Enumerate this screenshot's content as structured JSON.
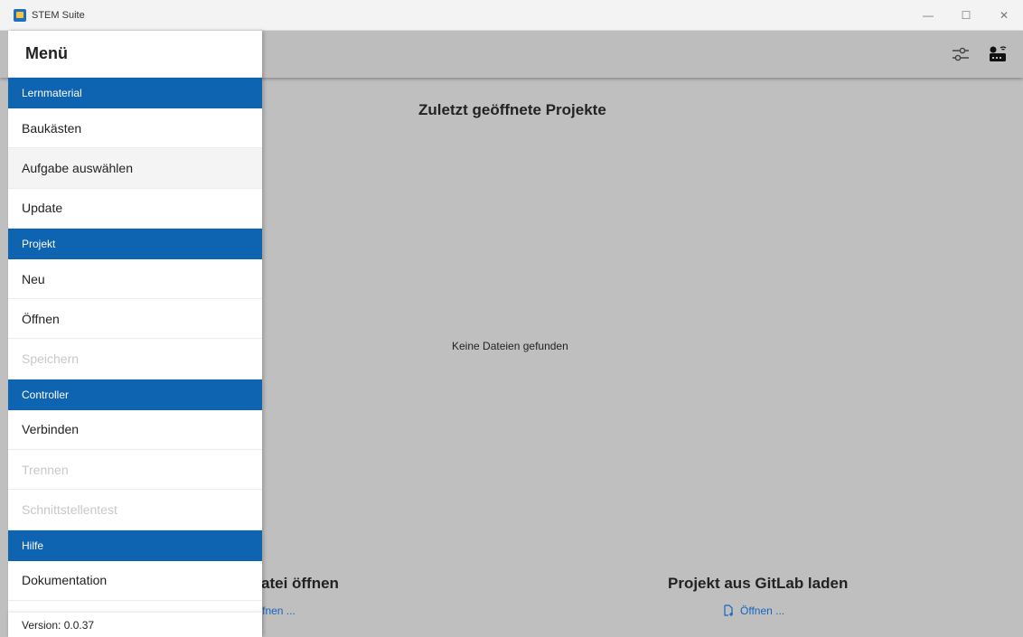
{
  "window": {
    "title": "STEM Suite",
    "controls": {
      "minimize": "—",
      "maximize": "☐",
      "close": "✕"
    }
  },
  "appbar": {
    "icons": [
      "settings-sliders-icon",
      "controller-device-icon"
    ]
  },
  "main": {
    "recent_title": "Zuletzt geöffnete Projekte",
    "empty_message": "Keine Dateien gefunden",
    "open_file": {
      "title": "atei öffnen",
      "link": "ffnen ..."
    },
    "gitlab": {
      "title": "Projekt aus GitLab laden",
      "link": "Öffnen ..."
    }
  },
  "drawer": {
    "title": "Menü",
    "sections": [
      {
        "label": "Lernmaterial",
        "items": [
          {
            "label": "Baukästen",
            "disabled": false
          },
          {
            "label": "Aufgabe auswählen",
            "disabled": false
          },
          {
            "label": "Update",
            "disabled": false
          }
        ]
      },
      {
        "label": "Projekt",
        "items": [
          {
            "label": "Neu",
            "disabled": false
          },
          {
            "label": "Öffnen",
            "disabled": false
          },
          {
            "label": "Speichern",
            "disabled": true
          }
        ]
      },
      {
        "label": "Controller",
        "items": [
          {
            "label": "Verbinden",
            "disabled": false
          },
          {
            "label": "Trennen",
            "disabled": true
          },
          {
            "label": "Schnittstellentest",
            "disabled": true
          }
        ]
      },
      {
        "label": "Hilfe",
        "items": [
          {
            "label": "Dokumentation",
            "disabled": false
          }
        ]
      }
    ],
    "version": "Version: 0.0.37"
  },
  "colors": {
    "section_bg": "#0e64b0",
    "link": "#1565c0",
    "disabled_text": "#c8c8c8",
    "overlay_bg": "#bfbfbf"
  }
}
